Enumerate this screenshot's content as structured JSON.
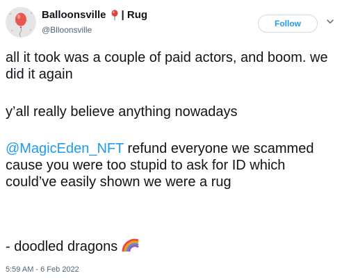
{
  "tweet": {
    "author": {
      "display_name": "Balloonsville",
      "name_emoji": "pushpin-balloon-icon",
      "name_suffix": "| Rug",
      "handle": "@Blloonsville",
      "avatar_icon": "balloon-avatar-icon"
    },
    "follow_label": "Follow",
    "more_icon": "chevron-down-icon",
    "paragraph_1": "all it took was a couple of paid actors, and boom. we did it again",
    "paragraph_2": "y’all really believe anything nowadays",
    "mention": "@MagicEden_NFT",
    "paragraph_3_rest": " refund everyone we scammed cause you were too stupid to ask for ID which could’ve easily shown we were a rug",
    "paragraph_4": "- doodled dragons",
    "trailing_emoji": "rainbow-icon",
    "timestamp": "5:59 AM - 6 Feb 2022"
  },
  "colors": {
    "link_blue": "#1d9bf0",
    "text_primary": "#0f1419",
    "text_secondary": "#536471",
    "button_border": "#cfd9de",
    "avatar_balloon": "#e8574f"
  }
}
